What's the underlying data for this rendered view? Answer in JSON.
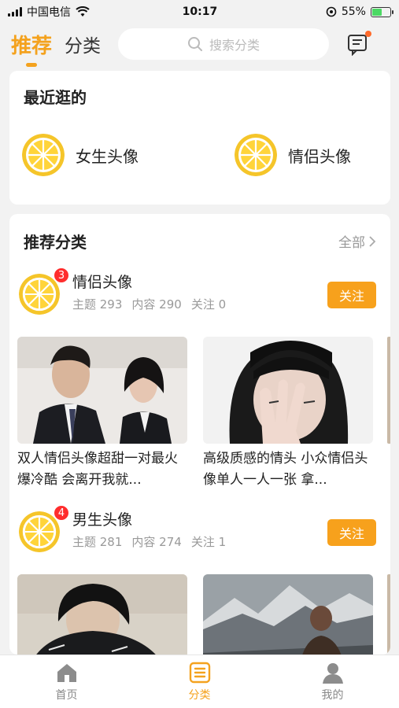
{
  "status": {
    "carrier": "中国电信",
    "time": "10:17",
    "battery": "55%",
    "battery_level": 0.55
  },
  "header": {
    "tab_recommend": "推荐",
    "tab_category": "分类",
    "search_placeholder": "搜索分类"
  },
  "recent": {
    "title": "最近逛的",
    "items": [
      {
        "label": "女生头像"
      },
      {
        "label": "情侣头像"
      }
    ]
  },
  "recommend": {
    "title": "推荐分类",
    "see_all": "全部",
    "categories": [
      {
        "name": "情侣头像",
        "badge": "3",
        "topics": "主题 293",
        "contents": "内容 290",
        "follows": "关注 0",
        "follow_label": "关注",
        "posts": [
          {
            "caption": "双人情侣头像超甜一对最火爆冷酷 会离开我就..."
          },
          {
            "caption": "高级质感的情头 小众情侣头像单人一人一张 拿..."
          }
        ]
      },
      {
        "name": "男生头像",
        "badge": "4",
        "topics": "主题 281",
        "contents": "内容 274",
        "follows": "关注 1",
        "follow_label": "关注",
        "posts": [
          {
            "caption": ""
          },
          {
            "caption": ""
          }
        ]
      }
    ]
  },
  "nav": {
    "home": "首页",
    "category": "分类",
    "mine": "我的"
  },
  "colors": {
    "accent": "#f4a21e",
    "follow_button": "#f7a11c",
    "badge": "#ff2d2d"
  }
}
